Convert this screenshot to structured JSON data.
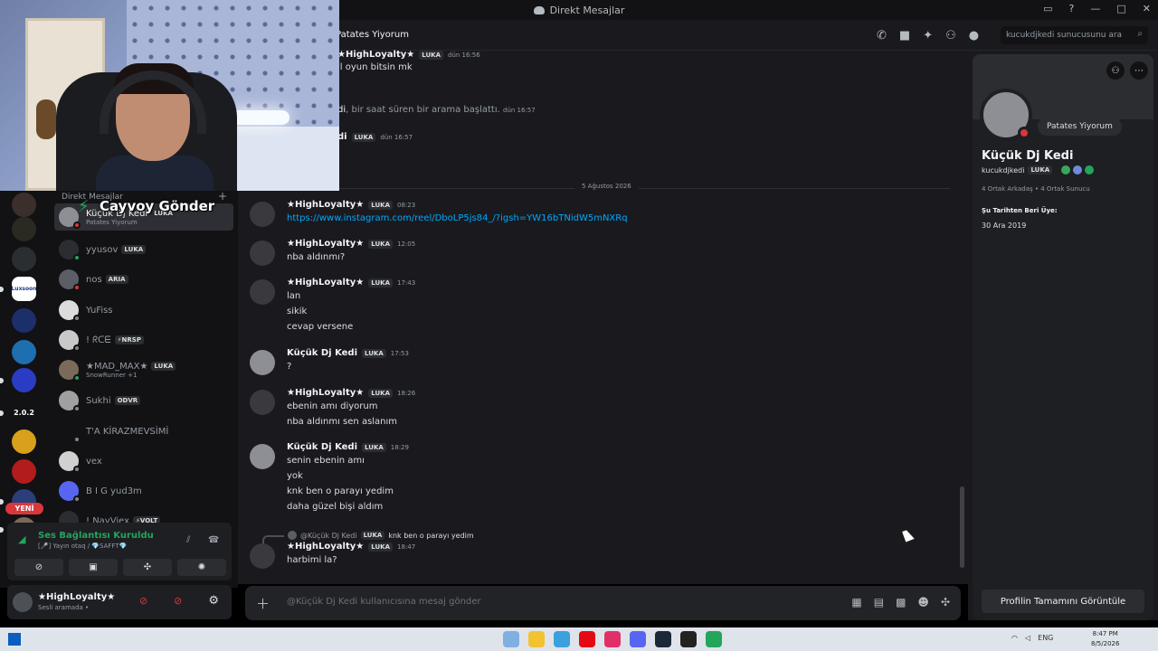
{
  "window": {
    "title": "Direkt Mesajlar",
    "controls": [
      "▭",
      "?",
      "—",
      "□",
      "✕"
    ]
  },
  "header": {
    "channel_name": "Patates Yiyorum",
    "search_placeholder": "kucukdjkedi sunucusunu ara"
  },
  "overlay": {
    "text": "Cayvoy Gönder"
  },
  "servers": {
    "badge_new": "YENİ",
    "items": [
      {
        "label": "",
        "color": "#3a2f2a"
      },
      {
        "label": "",
        "color": "#2a2a22"
      },
      {
        "label": "",
        "color": "#2a2d31"
      },
      {
        "label": "Luxsoon",
        "color": "#ffffff"
      },
      {
        "label": "",
        "color": "#1d2f6b"
      },
      {
        "label": "",
        "color": "#1e6fb0"
      },
      {
        "label": "",
        "color": "#2b3cc4"
      },
      {
        "label": "2.0.2",
        "color": "#121214"
      },
      {
        "label": "",
        "color": "#d8a01b"
      },
      {
        "label": "",
        "color": "#b21c1c"
      },
      {
        "label": "",
        "color": "#2b3e7a"
      },
      {
        "label": "",
        "color": "#7a6a5a"
      }
    ]
  },
  "dm_list": {
    "header": "Direkt Mesajlar",
    "plus": "+",
    "items": [
      {
        "name": "Küçük Dj Kedi",
        "tag": "LUKA",
        "sub": "Patates Yiyorum",
        "active": true,
        "avatar": "#8d8f95",
        "status": "#da373c"
      },
      {
        "name": "yyusov",
        "tag": "LUKA",
        "sub": "",
        "active": false,
        "avatar": "#2b2d31",
        "status": "#23a55a"
      },
      {
        "name": "nos",
        "tag": "ARIA",
        "sub": "",
        "active": false,
        "avatar": "#5c5e66",
        "status": "#da373c"
      },
      {
        "name": "YuFiss",
        "tag": "",
        "sub": "",
        "active": false,
        "avatar": "#dcdcdc",
        "status": "#80848e"
      },
      {
        "name": "! ᖇᑕᗴ",
        "tag": "⚡NRSP",
        "sub": "",
        "active": false,
        "avatar": "#c9c9c9",
        "status": "#80848e"
      },
      {
        "name": "★MAD_MAX★",
        "tag": "LUKA",
        "sub": "SnowRunner +1",
        "active": false,
        "avatar": "#7a6a5a",
        "status": "#23a55a"
      },
      {
        "name": "Sukhi",
        "tag": "ODVR",
        "sub": "",
        "active": false,
        "avatar": "#a0a0a0",
        "status": "#80848e"
      },
      {
        "name": "T'A KİRAZMEVSİMİ",
        "tag": "",
        "sub": "",
        "active": false,
        "avatar": "#121214",
        "status": "#80848e"
      },
      {
        "name": "vex",
        "tag": "",
        "sub": "",
        "active": false,
        "avatar": "#d0d0d0",
        "status": "#80848e"
      },
      {
        "name": "B I G yud3m",
        "tag": "",
        "sub": "",
        "active": false,
        "avatar": "#5865f2",
        "status": "#80848e"
      },
      {
        "name": "! NayViex",
        "tag": "⚡VOLT",
        "sub": "",
        "active": false,
        "avatar": "#2b2d31",
        "status": "#80848e"
      }
    ]
  },
  "voice": {
    "title": "Ses Bağlantısı Kuruldu",
    "sub": "[🎤] Yayın otaq / 💎SAFFT💎"
  },
  "user_panel": {
    "name": "★HighLoyalty★",
    "status": "Sesli aramada •"
  },
  "chat": {
    "top_messages": [
      {
        "author": "★HighLoyalty★",
        "tag": "LUKA",
        "time": "dün 16:56",
        "line": "il oyun bitsin mk"
      },
      {
        "system_prefix": "di",
        "system_text": ", bir saat süren bir arama başlattı.",
        "time": "dün 16:57"
      },
      {
        "author": "di",
        "tag": "LUKA",
        "time": "dün 16:57"
      }
    ],
    "date_divider": "5 Ağustos 2026",
    "messages": [
      {
        "author": "★HighLoyalty★",
        "tag": "LUKA",
        "time": "08:23",
        "lines": [],
        "link": "https://www.instagram.com/reel/DboLP5js84_/?igsh=YW16bTNidW5mNXRq",
        "avatar": "#3a3a3e"
      },
      {
        "author": "★HighLoyalty★",
        "tag": "LUKA",
        "time": "12:05",
        "lines": [
          "nba aldınmı?"
        ],
        "avatar": "#3a3a3e"
      },
      {
        "author": "★HighLoyalty★",
        "tag": "LUKA",
        "time": "17:43",
        "lines": [
          "lan",
          "sikik",
          "cevap versene"
        ],
        "avatar": "#3a3a3e"
      },
      {
        "author": "Küçük Dj Kedi",
        "tag": "LUKA",
        "time": "17:53",
        "lines": [
          "?"
        ],
        "avatar": "#8d8f95"
      },
      {
        "author": "★HighLoyalty★",
        "tag": "LUKA",
        "time": "18:26",
        "lines": [
          "ebenin amı diyorum",
          "nba aldınmı sen aslanım"
        ],
        "avatar": "#3a3a3e"
      },
      {
        "author": "Küçük Dj Kedi",
        "tag": "LUKA",
        "time": "18:29",
        "lines": [
          "senin ebenin amı",
          "yok",
          "knk ben o parayı yedim",
          "daha güzel bişi aldım"
        ],
        "avatar": "#8d8f95"
      },
      {
        "author": "★HighLoyalty★",
        "tag": "LUKA",
        "time": "18:47",
        "lines": [
          "harbimi la?"
        ],
        "avatar": "#3a3a3e",
        "reply": {
          "author": "@Küçük Dj Kedi",
          "tag": "LUKA",
          "text": "knk ben o parayı yedim"
        }
      }
    ]
  },
  "composer": {
    "placeholder": "@Küçük Dj Kedi kullanıcısına mesaj gönder"
  },
  "profile": {
    "custom_status": "Patates Yiyorum",
    "display_name": "Küçük Dj Kedi",
    "username": "kucukdjkedi",
    "tag": "LUKA",
    "mutual_friends": "4 Ortak Arkadaş",
    "mutual_servers": "4 Ortak Sunucu",
    "member_since_label": "Şu Tarihten Beri Üye:",
    "member_since": "30 Ara 2019",
    "full_profile_button": "Profilin Tamamını Görüntüle"
  },
  "taskbar": {
    "lang": "ENG",
    "time": "8:47 PM",
    "date": "8/5/2026"
  }
}
